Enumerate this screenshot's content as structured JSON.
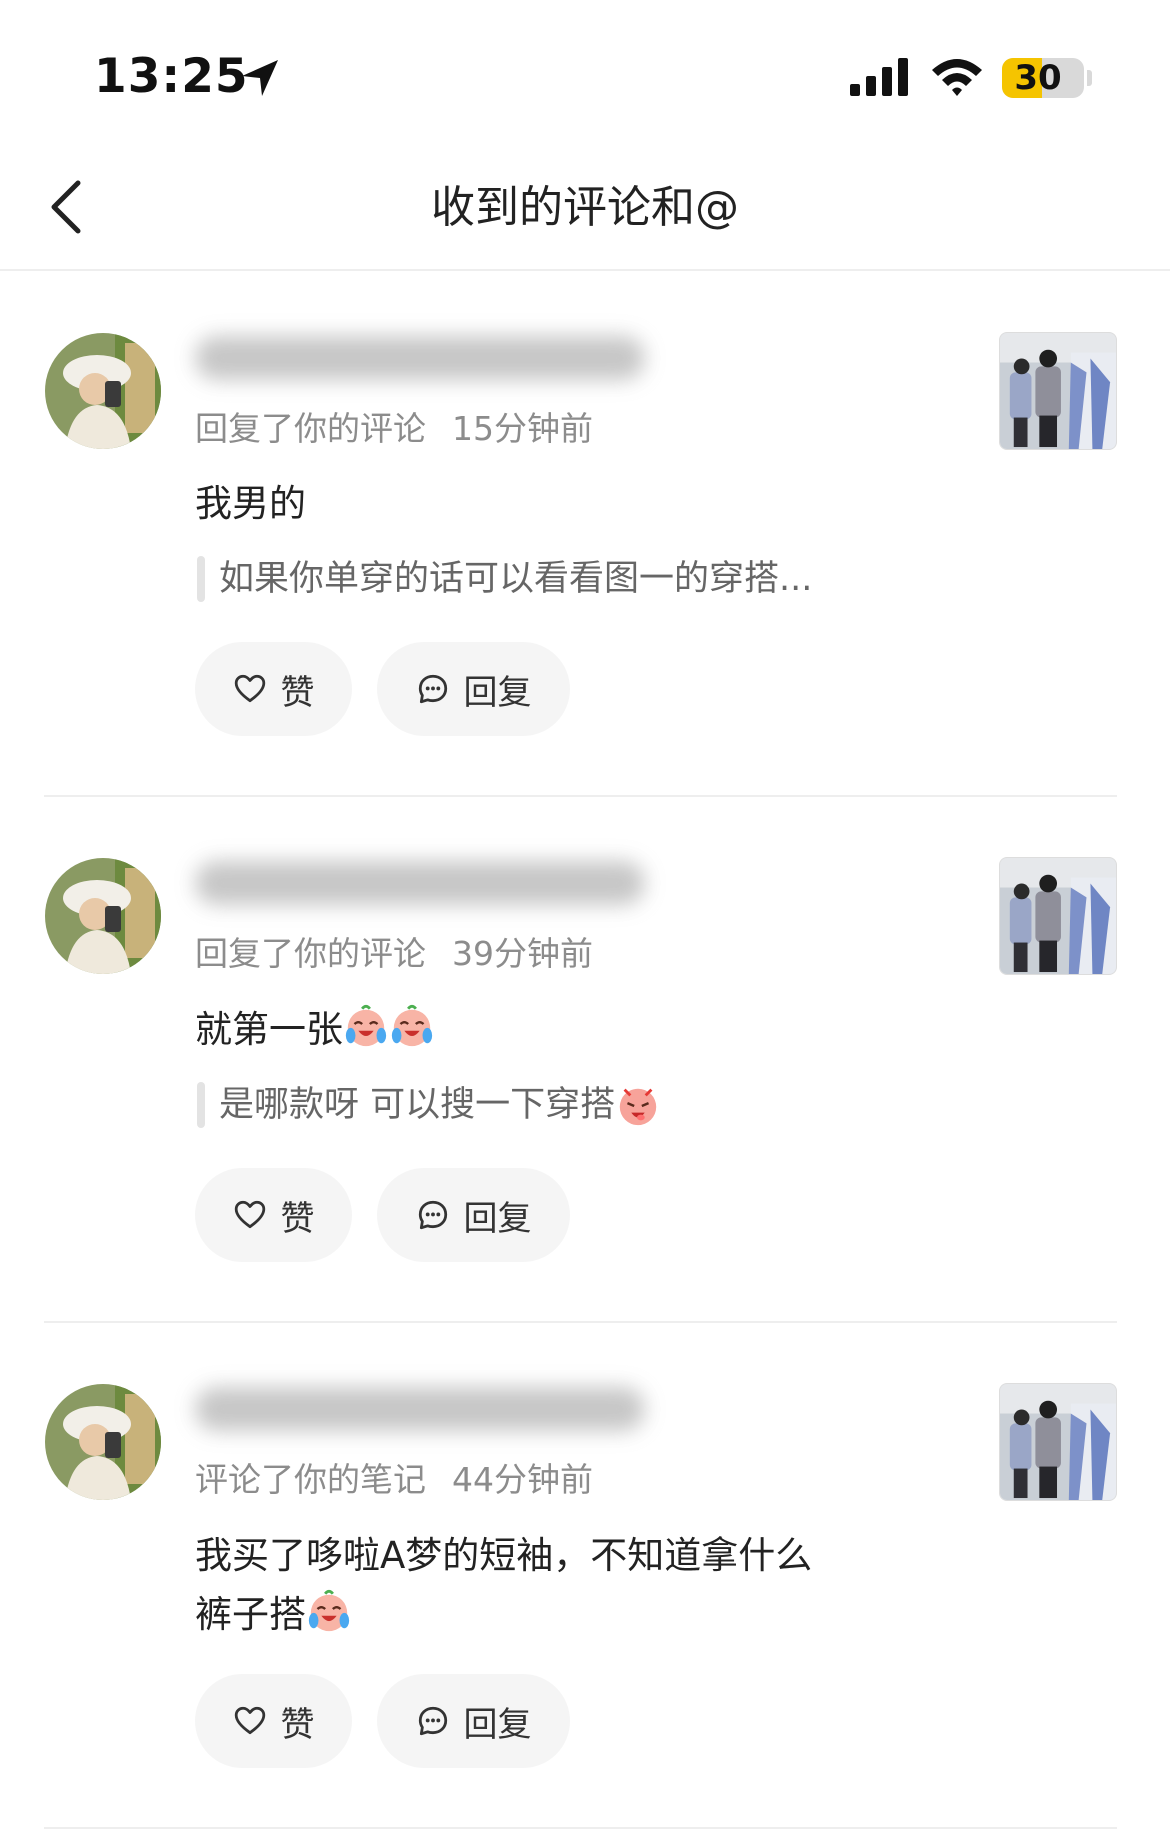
{
  "status_bar": {
    "time": "13:25",
    "battery": "30",
    "icons": [
      "location-arrow-icon",
      "cellular-signal-icon",
      "wifi-icon",
      "battery-icon"
    ]
  },
  "nav": {
    "title": "收到的评论和@",
    "back_icon": "chevron-left-icon"
  },
  "colors": {
    "battery_fill": "#f5c400",
    "meta_text": "#8c8c8c",
    "quote_bar": "#e3e3e3",
    "button_bg": "#f5f5f5"
  },
  "items": [
    {
      "action": "回复了你的评论",
      "time": "15分钟前",
      "comment": "我男的",
      "quote": "如果你单穿的话可以看看图一的穿搭...",
      "like_label": "赞",
      "reply_label": "回复"
    },
    {
      "action": "回复了你的评论",
      "time": "39分钟前",
      "comment": "就第一张",
      "comment_emojis": [
        "crying-laugh-emoji",
        "crying-laugh-emoji"
      ],
      "quote": "是哪款呀 可以搜一下穿搭",
      "quote_emojis": [
        "angry-face-emoji"
      ],
      "like_label": "赞",
      "reply_label": "回复"
    },
    {
      "action": "评论了你的笔记",
      "time": "44分钟前",
      "comment": "我买了哆啦A梦的短袖，不知道拿什么裤子搭",
      "comment_emojis": [
        "crying-laugh-emoji"
      ],
      "like_label": "赞",
      "reply_label": "回复"
    }
  ]
}
